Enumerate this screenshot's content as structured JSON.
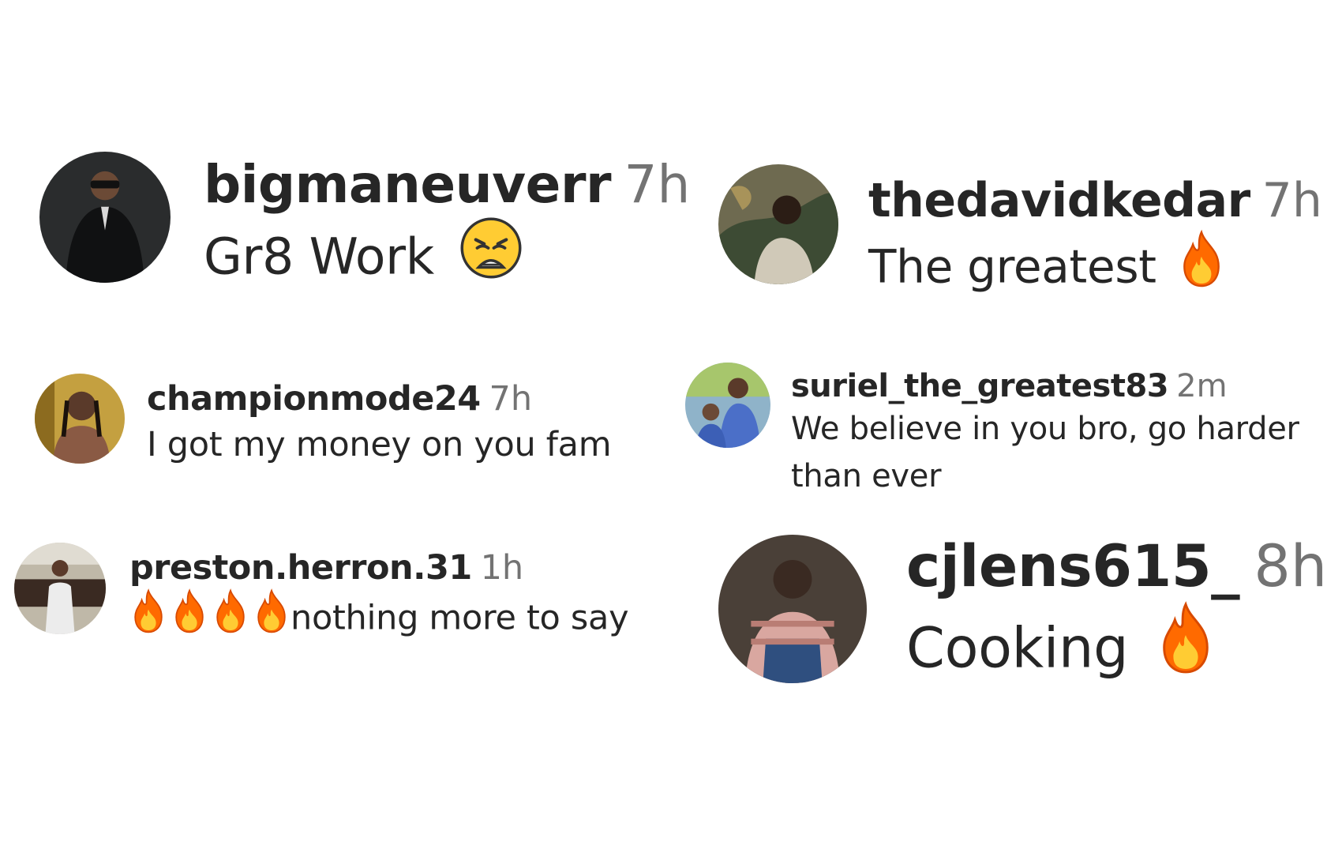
{
  "comments": [
    {
      "username": "bigmaneuverr",
      "time": "7h",
      "text": "Gr8 Work",
      "emoji": "weary-face-emoji"
    },
    {
      "username": "thedavidkedar",
      "time": "7h",
      "text": "The greatest",
      "emoji": "fire-emoji"
    },
    {
      "username": "championmode24",
      "time": "7h",
      "text": "I got my money on you fam"
    },
    {
      "username": "suriel_the_greatest83",
      "time": "2m",
      "text_line1": "We believe in you bro, go harder",
      "text_line2": "than ever"
    },
    {
      "username": "preston.herron.31",
      "time": "1h",
      "text": "nothing more to say",
      "emoji": "fire-emoji",
      "emoji_count": 4
    },
    {
      "username": "cjlens615_",
      "time": "8h",
      "text": "Cooking",
      "emoji": "fire-emoji"
    }
  ],
  "colors": {
    "username": "#262626",
    "timestamp": "#737373",
    "fire": "#ff6a00",
    "fire_inner": "#ffcc33"
  }
}
